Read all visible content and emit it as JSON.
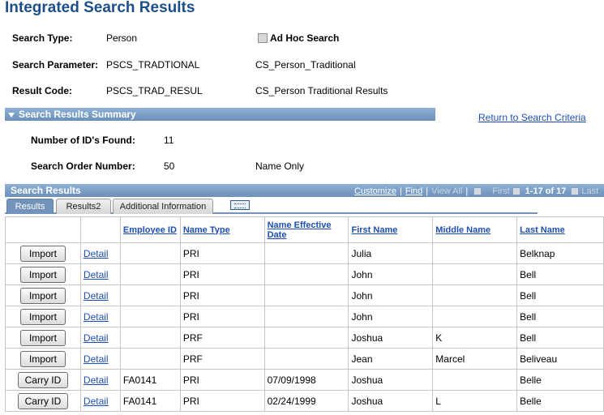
{
  "page_title": "Integrated Search Results",
  "fields": {
    "search_type_label": "Search Type:",
    "search_type_value": "Person",
    "adhoc_label": "Ad Hoc Search",
    "search_param_label": "Search Parameter:",
    "search_param_value": "PSCS_TRADTIONAL",
    "search_param_desc": "CS_Person_Traditional",
    "result_code_label": "Result Code:",
    "result_code_value": "PSCS_TRAD_RESUL",
    "result_code_desc": "CS_Person Traditional Results"
  },
  "summary": {
    "title": "Search Results Summary",
    "return_link": "Return to Search Criteria",
    "ids_found_label": "Number of ID's Found:",
    "ids_found_value": "11",
    "order_number_label": "Search Order Number:",
    "order_number_value": "50",
    "order_desc": "Name Only"
  },
  "grid": {
    "title": "Search Results",
    "nav": {
      "customize": "Customize",
      "find": "Find",
      "view_all": "View All",
      "first": "First",
      "range": "1-17 of 17",
      "last": "Last"
    },
    "tabs": [
      "Results",
      "Results2",
      "Additional Information"
    ],
    "columns": [
      "Employee ID",
      "Name Type",
      "Name Effective Date",
      "First Name",
      "Middle Name",
      "Last Name"
    ],
    "detail_label": "Detail",
    "rows": [
      {
        "button": "Import",
        "employee_id": "",
        "name_type": "PRI",
        "eff_date": "",
        "first": "Julia",
        "middle": "",
        "last": "Belknap"
      },
      {
        "button": "Import",
        "employee_id": "",
        "name_type": "PRI",
        "eff_date": "",
        "first": "John",
        "middle": "",
        "last": "Bell"
      },
      {
        "button": "Import",
        "employee_id": "",
        "name_type": "PRI",
        "eff_date": "",
        "first": "John",
        "middle": "",
        "last": "Bell"
      },
      {
        "button": "Import",
        "employee_id": "",
        "name_type": "PRI",
        "eff_date": "",
        "first": "John",
        "middle": "",
        "last": "Bell"
      },
      {
        "button": "Import",
        "employee_id": "",
        "name_type": "PRF",
        "eff_date": "",
        "first": "Joshua",
        "middle": "K",
        "last": "Bell"
      },
      {
        "button": "Import",
        "employee_id": "",
        "name_type": "PRF",
        "eff_date": "",
        "first": "Jean",
        "middle": "Marcel",
        "last": "Beliveau"
      },
      {
        "button": "Carry ID",
        "employee_id": "FA0141",
        "name_type": "PRI",
        "eff_date": "07/09/1998",
        "first": "Joshua",
        "middle": "",
        "last": "Belle"
      },
      {
        "button": "Carry ID",
        "employee_id": "FA0141",
        "name_type": "PRI",
        "eff_date": "02/24/1999",
        "first": "Joshua",
        "middle": "L",
        "last": "Belle"
      }
    ]
  }
}
